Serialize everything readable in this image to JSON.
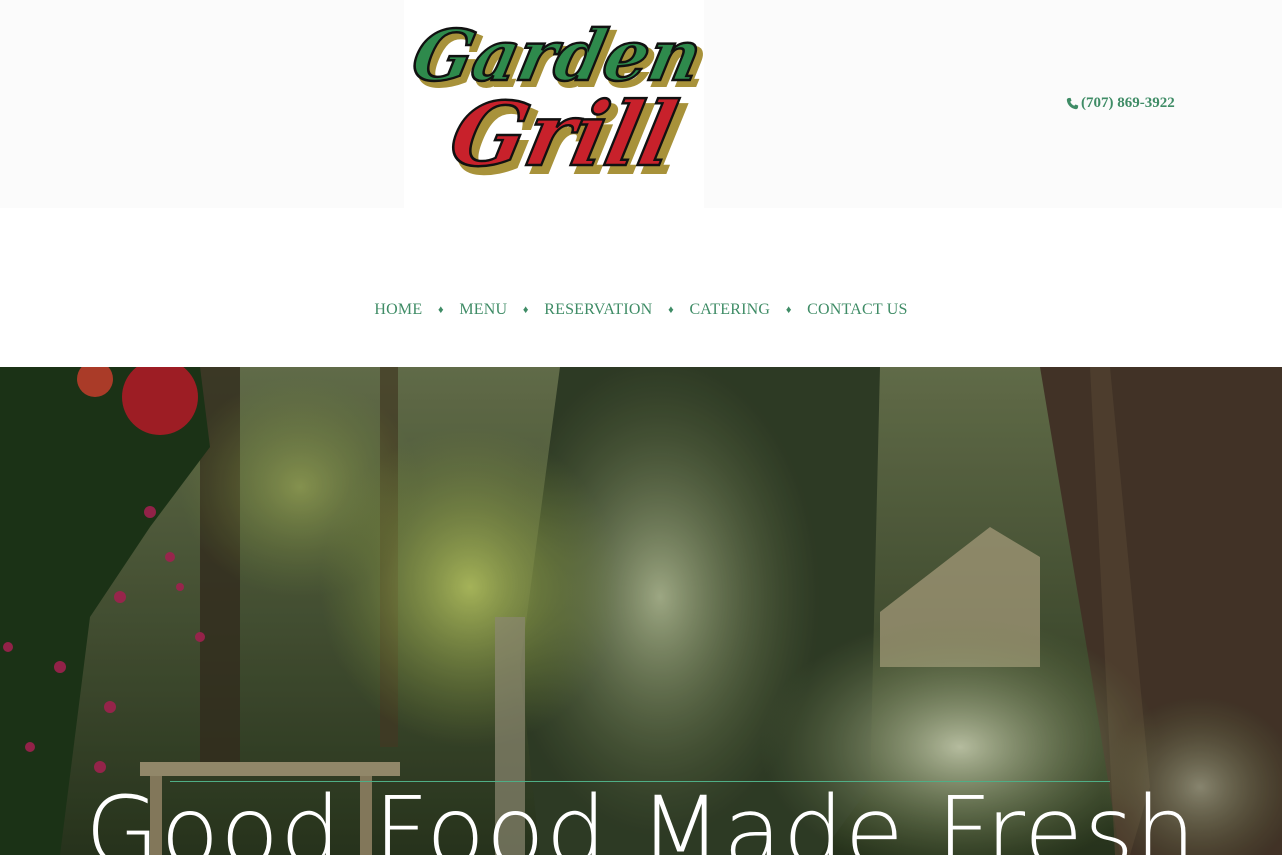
{
  "brand": {
    "logo_line1": "Garden",
    "logo_line2": "Grill",
    "colors": {
      "green": "#3f8c66",
      "logo_green": "#2e8a4c",
      "logo_red": "#c8212b",
      "logo_gold": "#a8923a"
    }
  },
  "header": {
    "phone_icon": "phone-icon",
    "phone": "(707) 869-3922"
  },
  "nav": {
    "separator": "♦",
    "items": [
      {
        "label": "HOME"
      },
      {
        "label": "MENU"
      },
      {
        "label": "RESERVATION"
      },
      {
        "label": "CATERING"
      },
      {
        "label": "CONTACT US"
      }
    ]
  },
  "hero": {
    "title": "Good Food Made Fresh",
    "accent_line_color": "#4fae86"
  }
}
